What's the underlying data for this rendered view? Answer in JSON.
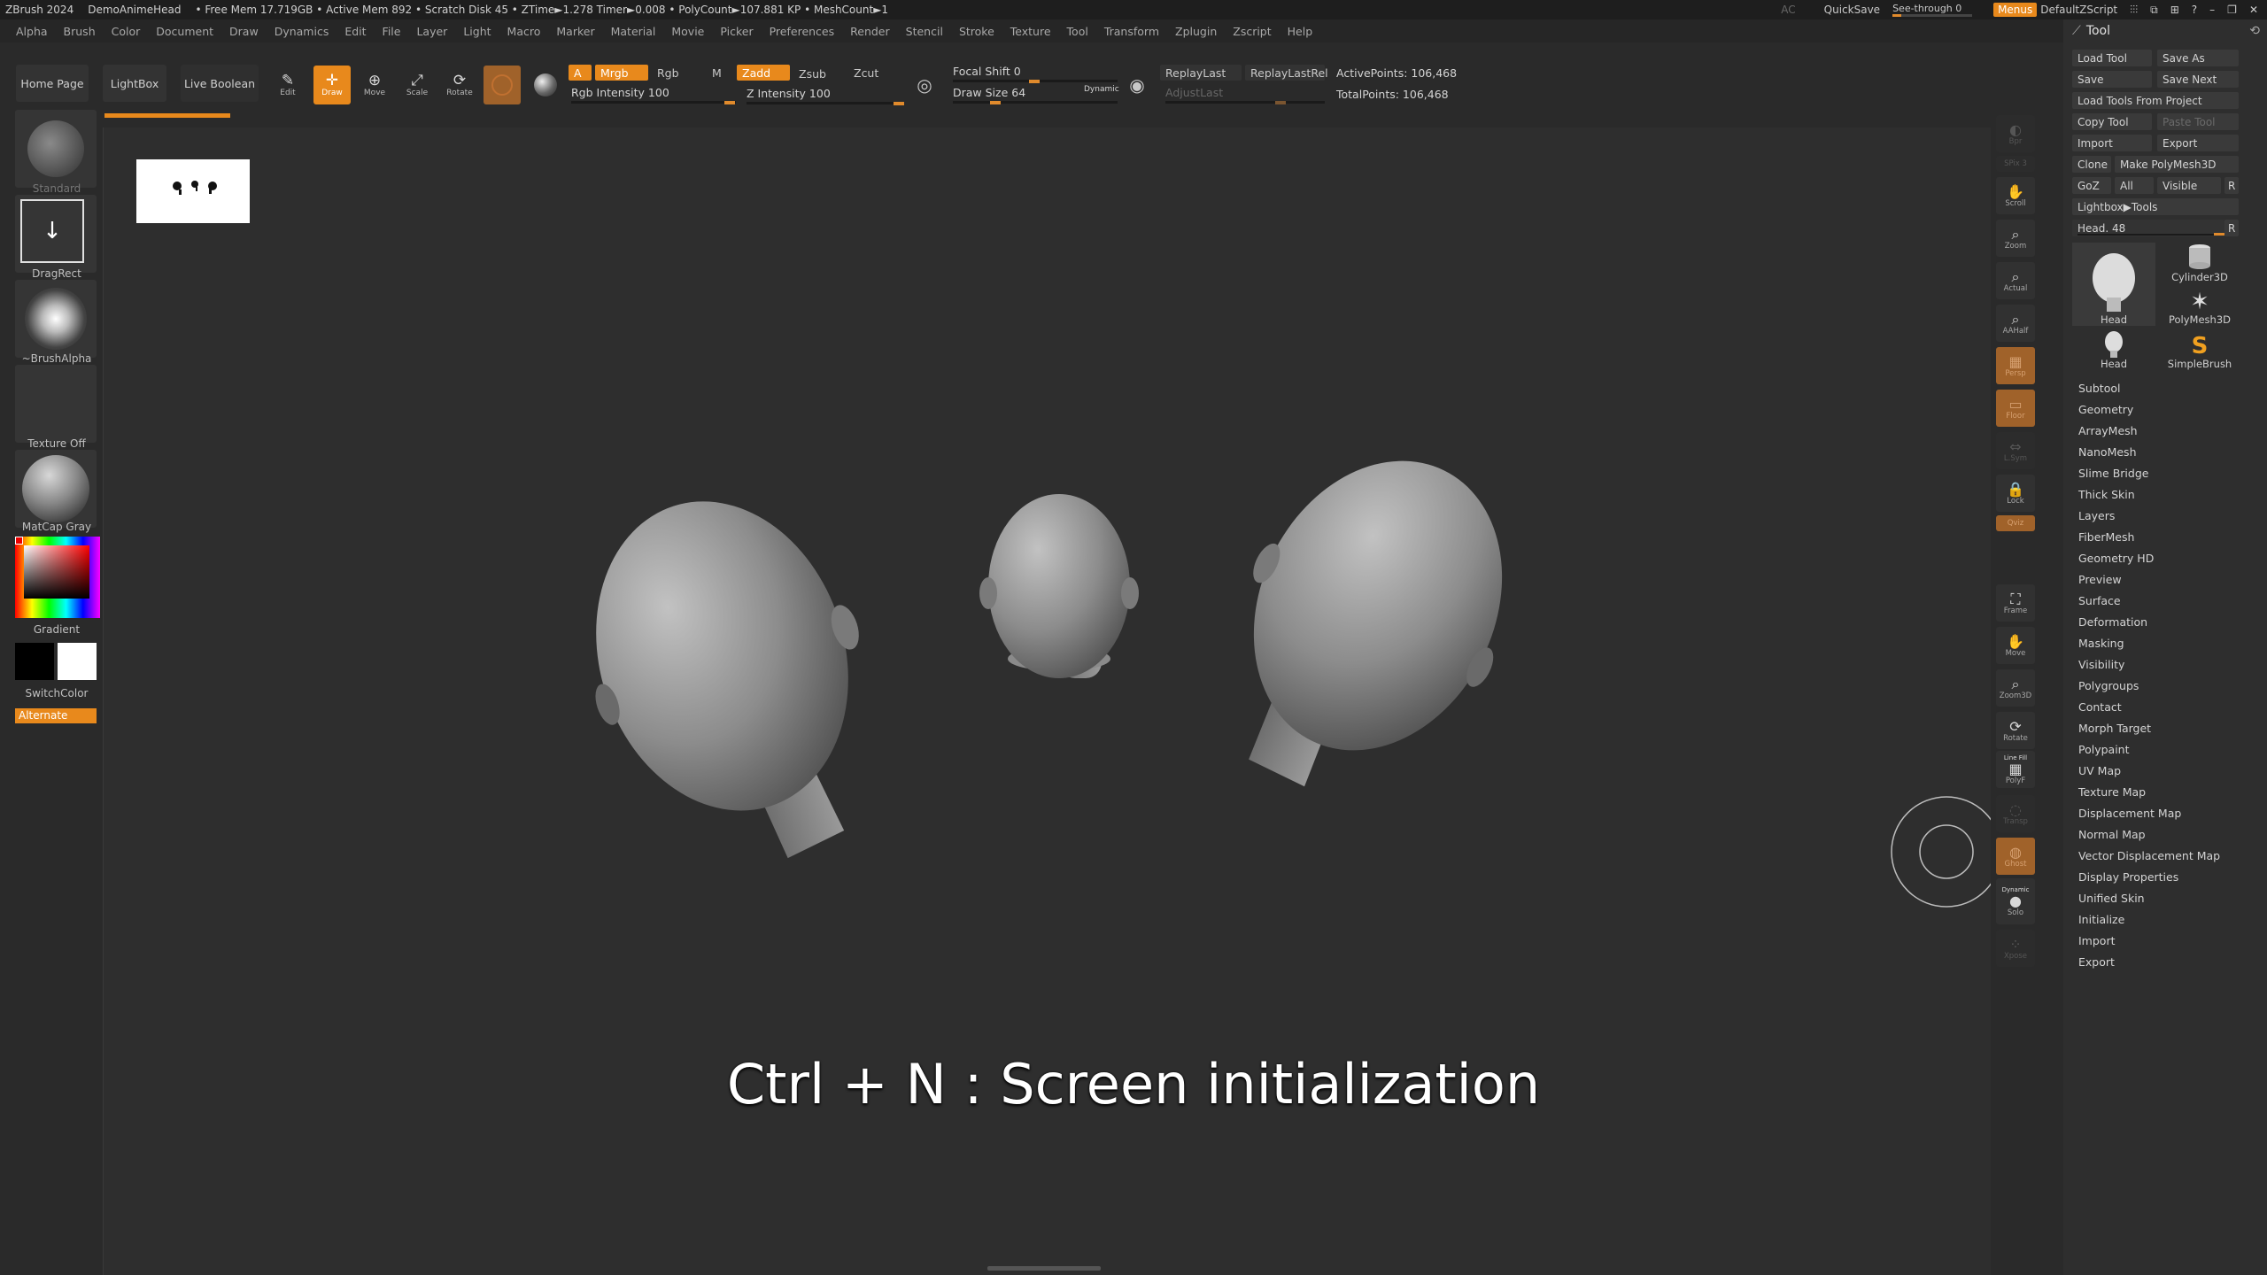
{
  "titlebar": {
    "app": "ZBrush 2024",
    "project": "DemoAnimeHead",
    "stats": "• Free Mem 17.719GB • Active Mem 892 • Scratch Disk 45 • ZTime►1.278 Timer►0.008 • PolyCount►107.881 KP • MeshCount►1",
    "ac": "AC",
    "quicksave": "QuickSave",
    "see_through": "See-through  0",
    "menus": "Menus",
    "default_zscript": "DefaultZScript"
  },
  "menubar": [
    "Alpha",
    "Brush",
    "Color",
    "Document",
    "Draw",
    "Dynamics",
    "Edit",
    "File",
    "Layer",
    "Light",
    "Macro",
    "Marker",
    "Material",
    "Movie",
    "Picker",
    "Preferences",
    "Render",
    "Stencil",
    "Stroke",
    "Texture",
    "Tool",
    "Transform",
    "Zplugin",
    "Zscript",
    "Help"
  ],
  "toolbar": {
    "home_page": "Home Page",
    "lightbox": "LightBox",
    "live_boolean": "Live Boolean",
    "edit": "Edit",
    "draw": "Draw",
    "move": "Move",
    "scale": "Scale",
    "rotate": "Rotate",
    "a": "A",
    "mrgb": "Mrgb",
    "rgb": "Rgb",
    "m": "M",
    "zadd": "Zadd",
    "zsub": "Zsub",
    "zcut": "Zcut",
    "rgb_intensity": "Rgb Intensity 100",
    "z_intensity": "Z Intensity 100",
    "focal_shift": "Focal Shift 0",
    "draw_size": "Draw Size 64",
    "dynamic": "Dynamic",
    "replay_last": "ReplayLast",
    "replay_last_rel": "ReplayLastRel",
    "adjust_last": "AdjustLast",
    "active_points": "ActivePoints: 106,468",
    "total_points": "TotalPoints: 106,468"
  },
  "leftshelf": {
    "brush": "Standard",
    "stroke": "DragRect",
    "alpha": "~BrushAlpha",
    "texture": "Texture Off",
    "material": "MatCap Gray",
    "gradient": "Gradient",
    "switch_color": "SwitchColor",
    "alternate": "Alternate"
  },
  "rightshelf": [
    "Bpr",
    "SPix 3",
    "Scroll",
    "Zoom",
    "Actual",
    "AAHalf",
    "Persp",
    "Floor",
    "L.Sym",
    "Lock",
    "Qviz",
    "Frame",
    "Move",
    "Zoom3D",
    "Rotate",
    "Line Fill",
    "PolyF",
    "Transp",
    "Ghost",
    "Dynamic",
    "Solo",
    "Xpose"
  ],
  "toolpanel": {
    "title": "Tool",
    "load_tool": "Load Tool",
    "save_as": "Save As",
    "save": "Save",
    "save_next": "Save Next",
    "load_tools_from_project": "Load Tools From Project",
    "copy_tool": "Copy Tool",
    "paste_tool": "Paste Tool",
    "import": "Import",
    "export": "Export",
    "clone": "Clone",
    "make_polymesh": "Make PolyMesh3D",
    "goz": "GoZ",
    "all": "All",
    "visible": "Visible",
    "r": "R",
    "lightbox_tools": "Lightbox▶Tools",
    "head_slider": "Head. 48",
    "thumbs": [
      "Head",
      "Cylinder3D",
      "PolyMesh3D",
      "Head",
      "SimpleBrush"
    ],
    "subpalettes": [
      "Subtool",
      "Geometry",
      "ArrayMesh",
      "NanoMesh",
      "Slime Bridge",
      "Thick Skin",
      "Layers",
      "FiberMesh",
      "Geometry HD",
      "Preview",
      "Surface",
      "Deformation",
      "Masking",
      "Visibility",
      "Polygroups",
      "Contact",
      "Morph Target",
      "Polypaint",
      "UV Map",
      "Texture Map",
      "Displacement Map",
      "Normal Map",
      "Vector Displacement Map",
      "Display Properties",
      "Unified Skin",
      "Initialize",
      "Import",
      "Export"
    ]
  },
  "caption": "Ctrl + N : Screen initialization",
  "colors": {
    "accent": "#e8891c",
    "bg": "#2e2e2e"
  }
}
